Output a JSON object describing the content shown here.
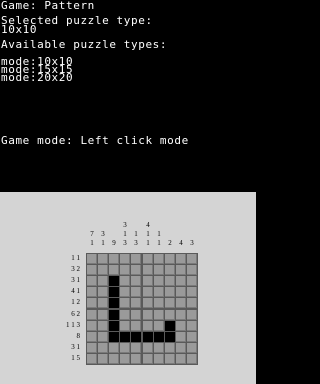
{
  "top": {
    "game_line": "Game: Pattern",
    "selected_label": "Selected puzzle type:",
    "selected_value": "10x10",
    "available_label": "Available puzzle types:",
    "modes": [
      "mode:10x10",
      "mode:15x15",
      "mode:20x20"
    ],
    "game_mode_line": "Game mode: Left click mode"
  },
  "puzzle": {
    "size": 10,
    "column_clues": [
      [
        "7",
        "1"
      ],
      [
        "3",
        "1"
      ],
      [
        "9"
      ],
      [
        "3",
        "1",
        "3"
      ],
      [
        "1",
        "3"
      ],
      [
        "4",
        "1",
        "1"
      ],
      [
        "1",
        "1"
      ],
      [
        "2"
      ],
      [
        "4"
      ],
      [
        "3"
      ]
    ],
    "row_clues": [
      "1 1",
      "3 2",
      "3 1",
      "4 1",
      "1 2",
      "6 2",
      "1 1 3",
      "8",
      "3 1",
      "1 5"
    ],
    "filled_cells": [
      [
        2,
        2
      ],
      [
        3,
        2
      ],
      [
        4,
        2
      ],
      [
        5,
        2
      ],
      [
        6,
        2
      ],
      [
        7,
        2
      ],
      [
        7,
        3
      ],
      [
        7,
        4
      ],
      [
        7,
        5
      ],
      [
        7,
        6
      ],
      [
        6,
        7
      ],
      [
        7,
        7
      ]
    ]
  }
}
